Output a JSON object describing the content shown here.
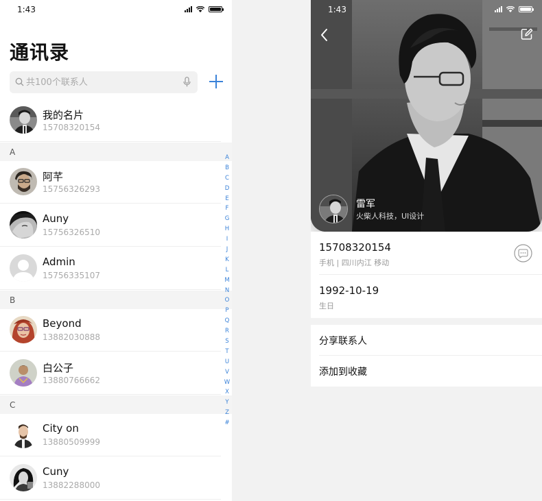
{
  "left": {
    "status": {
      "time": "1:43"
    },
    "title": "通讯录",
    "search": {
      "placeholder": "共100个联系人"
    },
    "my_card": {
      "name": "我的名片",
      "phone": "15708320154"
    },
    "sections": [
      {
        "letter": "A",
        "contacts": [
          {
            "name": "阿芊",
            "phone": "15756326293"
          },
          {
            "name": "Auny",
            "phone": "15756326510"
          },
          {
            "name": "Admin",
            "phone": "15756335107"
          }
        ]
      },
      {
        "letter": "B",
        "contacts": [
          {
            "name": "Beyond",
            "phone": "13882030888"
          },
          {
            "name": "白公子",
            "phone": "13880766662"
          }
        ]
      },
      {
        "letter": "C",
        "contacts": [
          {
            "name": "City on",
            "phone": "13880509999"
          },
          {
            "name": "Cuny",
            "phone": "13882288000"
          }
        ]
      }
    ],
    "index": [
      "A",
      "B",
      "C",
      "D",
      "E",
      "F",
      "G",
      "H",
      "I",
      "J",
      "K",
      "L",
      "M",
      "N",
      "O",
      "P",
      "Q",
      "R",
      "S",
      "T",
      "U",
      "V",
      "W",
      "X",
      "Y",
      "Z",
      "#"
    ]
  },
  "right": {
    "status": {
      "time": "1:43"
    },
    "profile": {
      "name": "雷军",
      "subtitle": "火柴人科技，UI设计"
    },
    "details": [
      {
        "value": "15708320154",
        "label": "手机 | 四川内江 移动"
      },
      {
        "value": "1992-10-19",
        "label": "生日"
      }
    ],
    "actions": [
      "分享联系人",
      "添加到收藏"
    ]
  },
  "colors": {
    "accent": "#3a82d8",
    "text": "#111111",
    "muted": "#aaaaaa",
    "background": "#f2f2f2"
  },
  "icons": [
    "search-icon",
    "microphone-icon",
    "plus-icon",
    "back-arrow-icon",
    "edit-icon",
    "message-icon",
    "signal-icon",
    "wifi-icon",
    "battery-icon"
  ]
}
